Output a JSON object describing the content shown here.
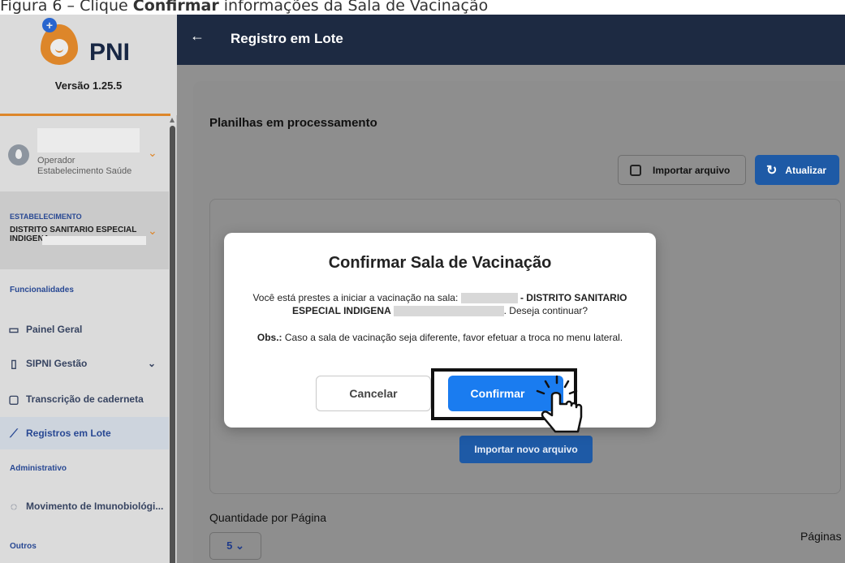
{
  "caption": {
    "prefix": "Figura 6 – Clique ",
    "bold": "Confirmar",
    "suffix": " informações da Sala de Vacinação"
  },
  "sidebar": {
    "app_name": "PNI",
    "version": "Versão 1.25.5",
    "user": {
      "role": "Operador",
      "unit": "Estabelecimento Saúde"
    },
    "estab": {
      "label": "ESTABELECIMENTO",
      "name_line1": "DISTRITO SANITARIO ESPECIAL",
      "name_line2": "INDIGENA."
    },
    "sections": {
      "funcionalidades": "Funcionalidades",
      "administrativo": "Administrativo",
      "outros": "Outros"
    },
    "items": {
      "painel": "Painel Geral",
      "sipni": "SIPNI Gestão",
      "transcricao": "Transcrição de caderneta",
      "registros": "Registros em Lote",
      "movimento": "Movimento de Imunobiológi..."
    }
  },
  "header": {
    "title": "Registro em Lote"
  },
  "main": {
    "panel_title": "Planilhas em processamento",
    "import_label": "Importar arquivo",
    "refresh_label": "Atualizar",
    "new_import_label": "Importar novo arquivo",
    "qty_label": "Quantidade por Página",
    "qty_value": "5",
    "pages_label": "Páginas"
  },
  "modal": {
    "title": "Confirmar Sala de Vacinação",
    "body_pre": "Você está prestes a iniciar a vacinação na sala: ",
    "body_bold1": " - DISTRITO SANITARIO",
    "body_bold2": "ESPECIAL INDIGENA ",
    "body_post": ". Deseja continuar?",
    "obs_label": "Obs.:",
    "obs_text": " Caso a sala de vacinação seja diferente, favor efetuar a troca no menu lateral.",
    "cancel_label": "Cancelar",
    "confirm_label": "Confirmar"
  },
  "colors": {
    "header_bg": "#1d2a42",
    "accent": "#1a7cf0",
    "brand_orange": "#f0922e"
  }
}
